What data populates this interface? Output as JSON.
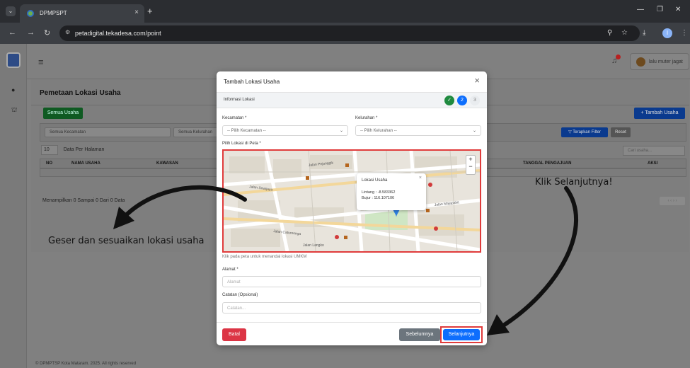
{
  "browser": {
    "tab_title": "DPMPSPT",
    "tab_close": "×",
    "new_tab": "+",
    "url": "petadigital.tekadesa.com/point",
    "profile_initial": "I"
  },
  "topbar": {
    "user_name": "lalu muter jagat"
  },
  "page": {
    "title": "Pemetaan Lokasi Usaha",
    "all_button": "Semua Usaha",
    "add_button": "+ Tambah Usaha",
    "filter_kecamatan": "Semua Kecamatan",
    "filter_kelurahan": "Semua Kelurahan",
    "apply_filter": "▽ Terapkan Filter",
    "reset": "Reset",
    "per_page_value": "10",
    "per_page_label": "Data Per Halaman",
    "search_placeholder": "Cari usaha...",
    "columns": [
      "NO",
      "NAMA USAHA",
      "KAWASAN",
      "TANGGAL PENGAJUAN",
      "AKSI"
    ],
    "summary": "Menampilkan 0 Sampai 0 Dari 0 Data",
    "footer": "© DPMPTSP Kota Mataram. 2025. All rights reserved"
  },
  "annotations": {
    "left_note": "Geser dan sesuaikan lokasi usaha",
    "right_note": "Klik Selanjutnya!"
  },
  "modal": {
    "title": "Tambah Lokasi Usaha",
    "close": "×",
    "section": "Informasi Lokasi",
    "steps": [
      "✓",
      "2",
      "3"
    ],
    "kecamatan_label": "Kecamatan *",
    "kecamatan_placeholder": "-- Pilih Kecamatan --",
    "kelurahan_label": "Kelurahan *",
    "kelurahan_placeholder": "-- Pilih Kelurahan --",
    "map_label": "Pilih Lokasi di Peta *",
    "map_caption": "Klik pada peta untuk menandai lokasi UMKM",
    "popup": {
      "title": "Lokasi Usaha",
      "close": "×",
      "lintang": "Lintang : -8.583362",
      "bujur": "Bujur : 116.107106"
    },
    "map_streets": [
      "Jalan Pejanggik",
      "Jalan Caturwarga",
      "Jalan Langko",
      "Jalan Sriwijaya",
      "Jalan Majapahit"
    ],
    "alamat_label": "Alamat *",
    "alamat_placeholder": "Alamat",
    "catatan_label": "Catatan (Opsional)",
    "catatan_placeholder": "Catatan...",
    "btn_cancel": "Batal",
    "btn_prev": "Sebelumnya",
    "btn_next": "Selanjutnya"
  }
}
